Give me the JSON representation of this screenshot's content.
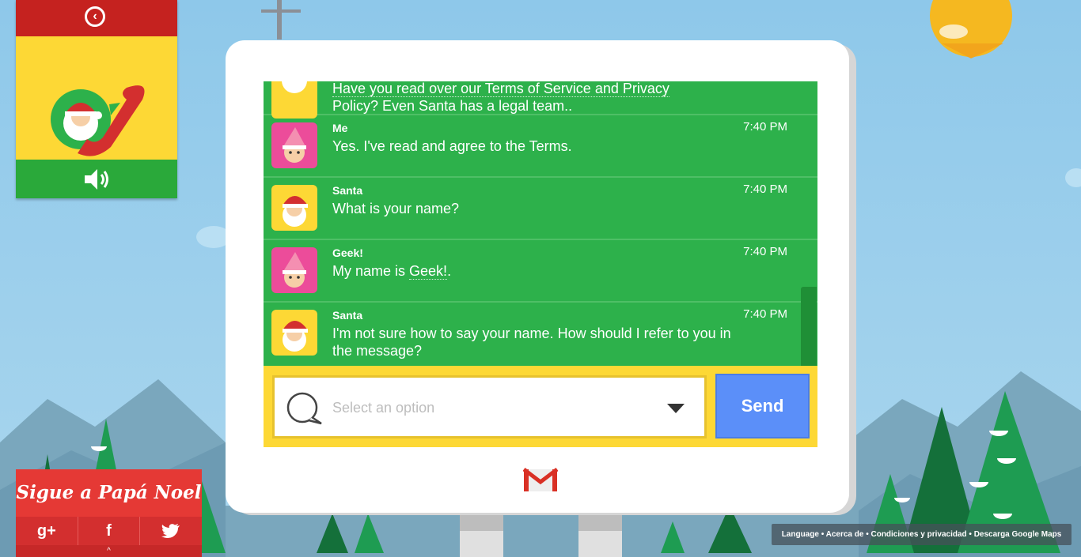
{
  "window": {
    "title": "Sigue a Papá Noel"
  },
  "call_panel": {
    "back_icon": "chevron-left-icon",
    "phone_icon": "santa-phone-icon",
    "speaker_icon": "speaker-icon"
  },
  "chat": {
    "messages": [
      {
        "sender": "",
        "time": "",
        "text": "Have you read over our Terms of Service and Privacy",
        "text2": "Policy? Even Santa has a legal team..",
        "avatar": "santa"
      },
      {
        "sender": "Me",
        "time": "7:40 PM",
        "text": "Yes. I've read and agree to the Terms.",
        "avatar": "elf"
      },
      {
        "sender": "Santa",
        "time": "7:40 PM",
        "text": "What is your name?",
        "avatar": "santa"
      },
      {
        "sender": "Geek!",
        "time": "7:40 PM",
        "text_pre": "My name is ",
        "text_link": "Geek!",
        "text_post": ".",
        "avatar": "elf"
      },
      {
        "sender": "Santa",
        "time": "7:40 PM",
        "text": "I'm not sure how to say your name. How should I refer to you in the message?",
        "avatar": "santa"
      }
    ]
  },
  "composer": {
    "placeholder": "Select an option",
    "send_label": "Send"
  },
  "social": {
    "title": "Sigue a Papá Noel",
    "buttons": [
      "g+",
      "f",
      "twitter"
    ]
  },
  "footer": {
    "items": [
      "Language",
      "Acerca de",
      "Condiciones y privacidad",
      "Descarga Google Maps"
    ],
    "separator": " • "
  },
  "colors": {
    "chat_green": "#2db14b",
    "panel_yellow": "#fdd835",
    "send_blue": "#5b8ff9",
    "social_red": "#e53935"
  }
}
